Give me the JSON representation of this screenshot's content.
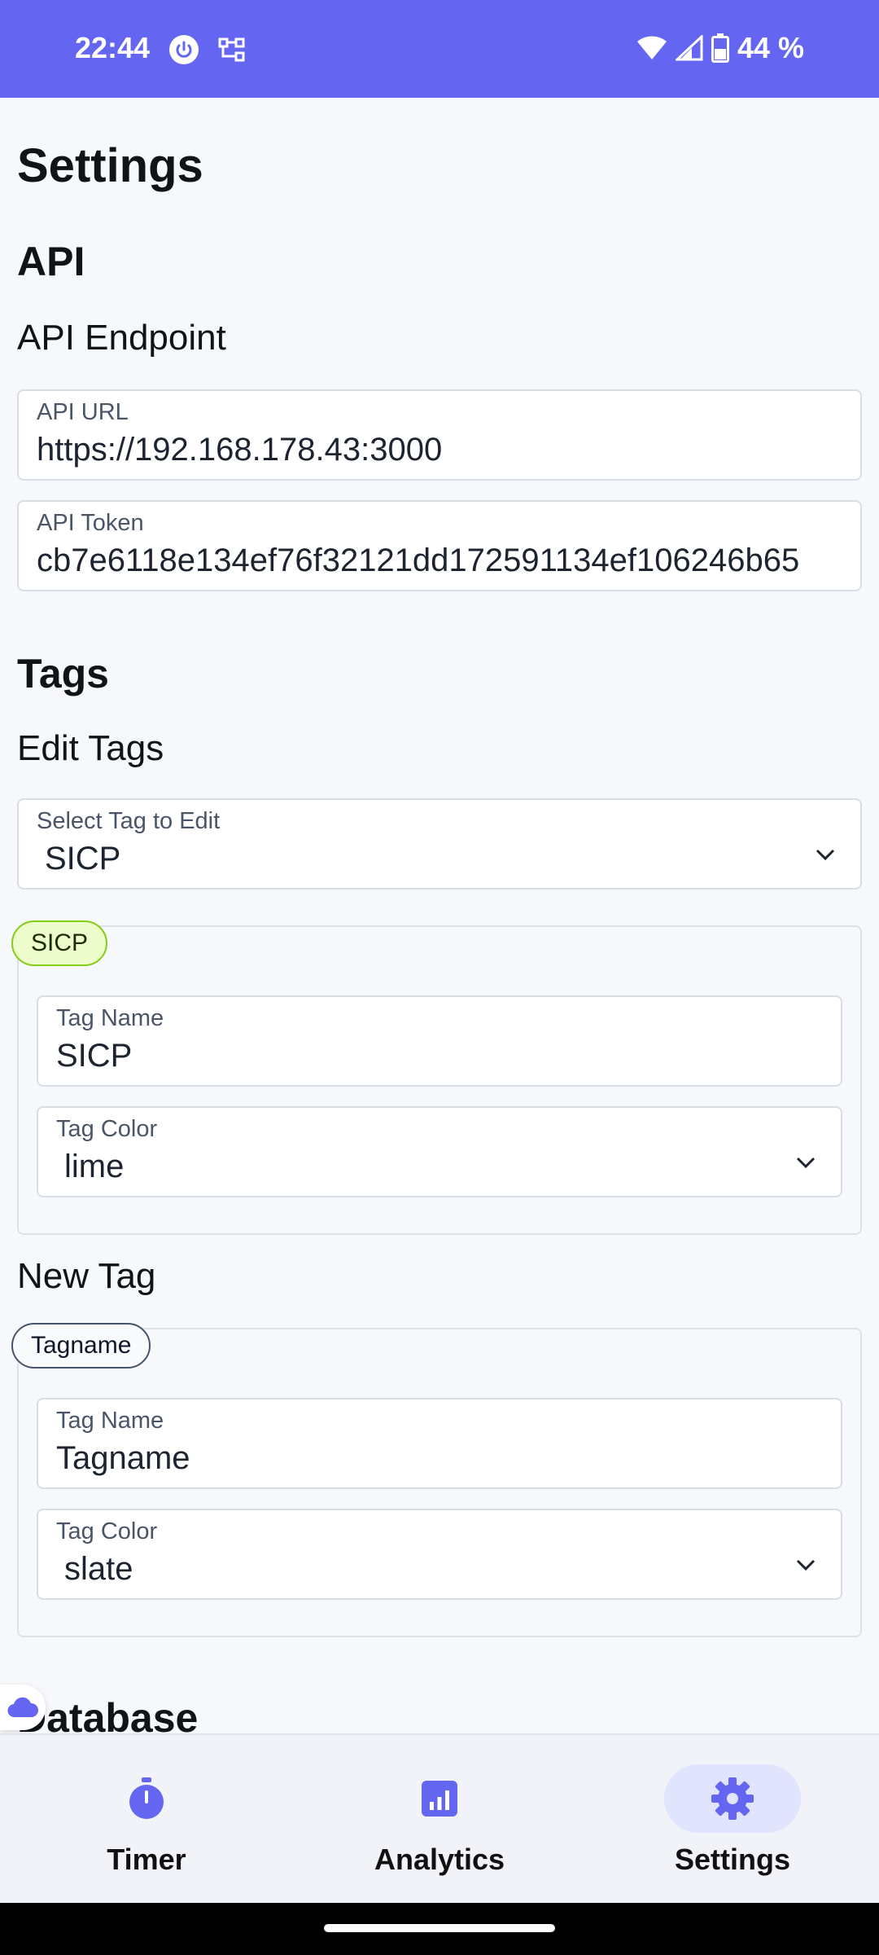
{
  "status_bar": {
    "time": "22:44",
    "battery": "44 %",
    "background": "#6466f1"
  },
  "page": {
    "title": "Settings"
  },
  "api": {
    "section_title": "API",
    "subtitle": "API Endpoint",
    "url_label": "API URL",
    "url_value": "https://192.168.178.43:3000",
    "token_label": "API Token",
    "token_value": "cb7e6118e134ef76f32121dd172591134ef106246b65"
  },
  "tags": {
    "section_title": "Tags",
    "edit_subtitle": "Edit Tags",
    "select_label": "Select Tag to Edit",
    "select_value": "SICP",
    "edit_card": {
      "chip": "SICP",
      "chip_color": "lime",
      "name_label": "Tag Name",
      "name_value": "SICP",
      "color_label": "Tag Color",
      "color_value": "lime"
    },
    "new_subtitle": "New Tag",
    "new_card": {
      "chip": "Tagname",
      "chip_color": "slate",
      "name_label": "Tag Name",
      "name_value": "Tagname",
      "color_label": "Tag Color",
      "color_value": "slate"
    }
  },
  "database": {
    "section_title": "Database"
  },
  "nav": {
    "items": [
      {
        "label": "Timer",
        "icon": "timer-icon",
        "active": false
      },
      {
        "label": "Analytics",
        "icon": "analytics-icon",
        "active": false
      },
      {
        "label": "Settings",
        "icon": "gear-icon",
        "active": true
      }
    ],
    "accent": "#6466f1"
  }
}
